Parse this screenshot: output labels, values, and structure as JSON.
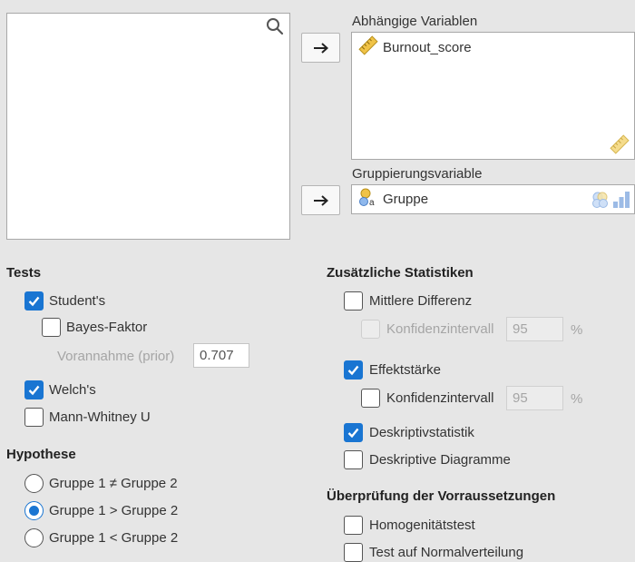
{
  "variables": {
    "dependent_label": "Abhängige Variablen",
    "dependent_items": [
      "Burnout_score"
    ],
    "grouping_label": "Gruppierungsvariable",
    "grouping_item": "Gruppe"
  },
  "tests": {
    "title": "Tests",
    "student": {
      "label": "Student's",
      "checked": true
    },
    "bayes": {
      "label": "Bayes-Faktor",
      "checked": false
    },
    "prior": {
      "label": "Vorannahme (prior)",
      "value": "0.707"
    },
    "welch": {
      "label": "Welch's",
      "checked": true
    },
    "mann": {
      "label": "Mann-Whitney U",
      "checked": false
    }
  },
  "hypothesis": {
    "title": "Hypothese",
    "options": [
      "Gruppe 1 ≠ Gruppe 2",
      "Gruppe 1 > Gruppe 2",
      "Gruppe 1 < Gruppe 2"
    ],
    "selected_index": 1
  },
  "additional": {
    "title": "Zusätzliche Statistiken",
    "mean_diff": {
      "label": "Mittlere Differenz",
      "checked": false
    },
    "ci1": {
      "label": "Konfidenzintervall",
      "value": "95",
      "unit": "%"
    },
    "effect": {
      "label": "Effektstärke",
      "checked": true
    },
    "ci2": {
      "label": "Konfidenzintervall",
      "value": "95",
      "unit": "%"
    },
    "descriptives": {
      "label": "Deskriptivstatistik",
      "checked": true
    },
    "desc_plots": {
      "label": "Deskriptive Diagramme",
      "checked": false
    }
  },
  "assumptions": {
    "title": "Überprüfung der Vorraussetzungen",
    "homogeneity": {
      "label": "Homogenitätstest",
      "checked": false
    },
    "normality": {
      "label": "Test auf Normalverteilung",
      "checked": false
    }
  },
  "colors": {
    "accent": "#1975d2",
    "ruler": "#f0c347",
    "nominal_blue": "#5b8fd8"
  }
}
